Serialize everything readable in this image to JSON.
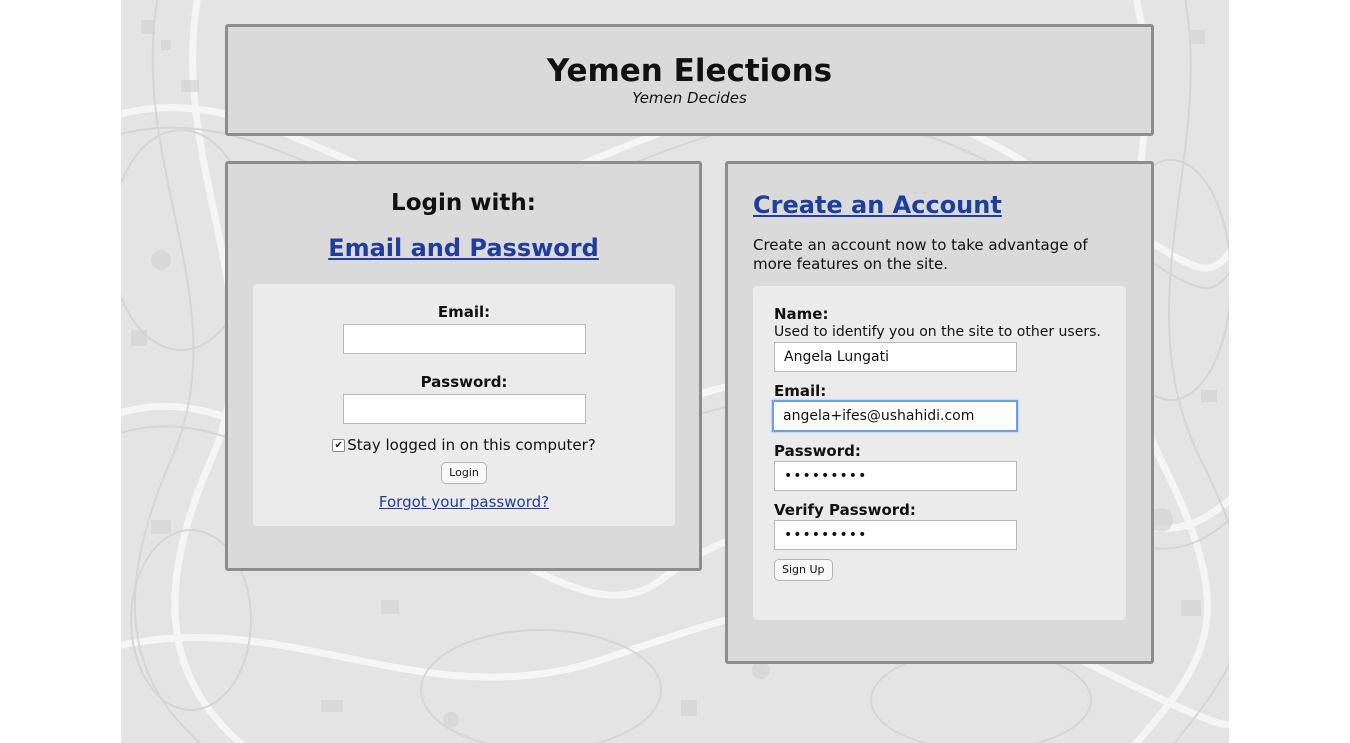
{
  "site": {
    "title": "Yemen Elections",
    "tagline": "Yemen Decides"
  },
  "login": {
    "heading": "Login with:",
    "method_link": "Email and Password",
    "email_label": "Email:",
    "email_value": "",
    "password_label": "Password:",
    "password_value": "",
    "remember_label": "Stay logged in on this computer?",
    "remember_checked": true,
    "submit_label": "Login",
    "forgot_link": "Forgot your password?"
  },
  "signup": {
    "heading": "Create an Account",
    "intro": "Create an account now to take advantage of more features on the site.",
    "name_label": "Name:",
    "name_hint": "Used to identify you on the site to other users.",
    "name_value": "Angela Lungati",
    "email_label": "Email:",
    "email_value": "angela+ifes@ushahidi.com",
    "password_label": "Password:",
    "password_mask": "•••••••••",
    "verify_label": "Verify Password:",
    "verify_mask": "•••••••••",
    "submit_label": "Sign Up"
  },
  "colors": {
    "link": "#1f3d9b",
    "panel": "#dadada",
    "panel_border": "#8d8d8d",
    "inner_box": "#ebebeb",
    "focus_ring": "#6aa0e6"
  }
}
